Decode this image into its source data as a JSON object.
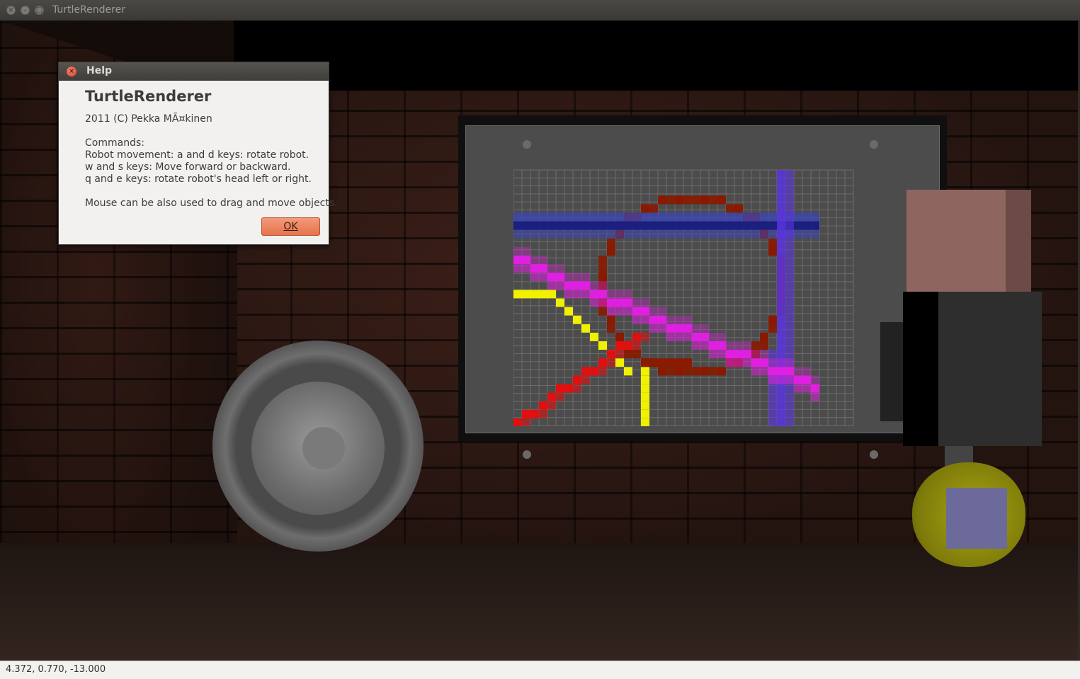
{
  "window": {
    "title": "TurtleRenderer",
    "buttons": [
      "close",
      "minimize",
      "maximize"
    ]
  },
  "help_dialog": {
    "title": "Help",
    "heading": "TurtleRenderer",
    "copyright": "2011 (C) Pekka MÃ¤kinen",
    "lines": [
      "Commands:",
      "Robot movement: a and d keys: rotate robot.",
      "w and s keys: Move forward or backward.",
      "q and e keys: rotate robot's head left or right.",
      "",
      "Mouse can be also used to drag and move objects."
    ],
    "ok_label": "OK"
  },
  "status_bar": {
    "coordinates": "4.372, 0.770, -13.000"
  },
  "colors": {
    "board_bg": "#4c4c4c",
    "paths": {
      "blue_dark": "#1a1f80",
      "blue_light": "#3a44b8",
      "red_dark": "#8a1a00",
      "violet": "#5b35e0",
      "magenta": "#e020e0",
      "yellow": "#f0f000",
      "red": "#e01010"
    },
    "robot_head": "#8f6560",
    "robot_base": "#a9a413",
    "dialog_ok": "#e5734c"
  },
  "icons": {
    "window_close": "close-icon",
    "dialog_close": "close-icon"
  }
}
